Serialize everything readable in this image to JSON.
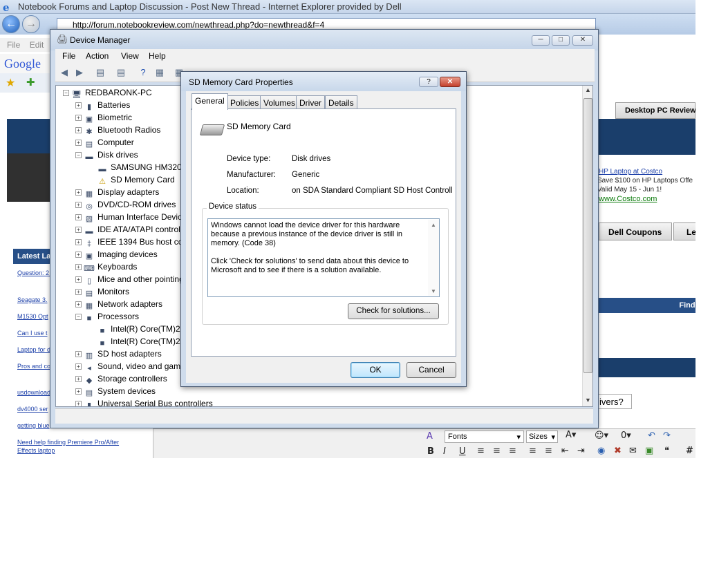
{
  "browser": {
    "title": "Notebook Forums and Laptop Discussion - Post New Thread - Internet Explorer provided by Dell",
    "address": "http://forum.notebookreview.com/newthread.php?do=newthread&f=4",
    "menu_file": "File",
    "menu_edit": "Edit",
    "google": "Google"
  },
  "site": {
    "latest_header": "Latest La",
    "links": [
      "Question: 2 Core 2 Duo",
      "Seagate 3.",
      "M1530 Opt",
      "Can I use t",
      "Laptop for d",
      "Pros and co resolutions",
      "usdownload",
      "dv4000 ser",
      "getting blue",
      "Need help finding Premiere Pro/After Effects laptop"
    ],
    "tab_desktop": "Desktop PC Reviews",
    "ad_title": "HP Laptop at Costco",
    "ad_line1": "Save $100 on HP Laptops Offe",
    "ad_line2": "Valid May 15 - Jun 1!",
    "ad_url": "www.Costco.com",
    "tab_dell": "Dell Coupons",
    "tab_le": "Le",
    "find_bar": "Find P",
    "question_tail": "ivers?",
    "editor_fonts": "Fonts",
    "editor_sizes": "Sizes"
  },
  "device_manager": {
    "title": "Device Manager",
    "menu": [
      "File",
      "Action",
      "View",
      "Help"
    ],
    "root": "REDBARONK-PC",
    "nodes": [
      {
        "label": "Batteries",
        "icon": "battery-icon"
      },
      {
        "label": "Biometric",
        "icon": "biometric-icon"
      },
      {
        "label": "Bluetooth Radios",
        "icon": "bluetooth-icon"
      },
      {
        "label": "Computer",
        "icon": "computer-icon"
      },
      {
        "label": "Disk drives",
        "icon": "disk-drive-icon"
      },
      {
        "label": "SAMSUNG HM320JI",
        "icon": "disk-drive-icon"
      },
      {
        "label": "SD Memory Card",
        "icon": "warning-disk-icon"
      },
      {
        "label": "Display adapters",
        "icon": "display-adapter-icon"
      },
      {
        "label": "DVD/CD-ROM drives",
        "icon": "dvd-icon"
      },
      {
        "label": "Human Interface Devices",
        "icon": "hid-icon"
      },
      {
        "label": "IDE ATA/ATAPI controllers",
        "icon": "ide-icon"
      },
      {
        "label": "IEEE 1394 Bus host controllers",
        "icon": "ieee1394-icon"
      },
      {
        "label": "Imaging devices",
        "icon": "camera-icon"
      },
      {
        "label": "Keyboards",
        "icon": "keyboard-icon"
      },
      {
        "label": "Mice and other pointing devices",
        "icon": "mouse-icon"
      },
      {
        "label": "Monitors",
        "icon": "monitor-icon"
      },
      {
        "label": "Network adapters",
        "icon": "network-icon"
      },
      {
        "label": "Processors",
        "icon": "processor-icon"
      },
      {
        "label": "Intel(R) Core(TM)2",
        "icon": "processor-icon"
      },
      {
        "label": "Intel(R) Core(TM)2",
        "icon": "processor-icon"
      },
      {
        "label": "SD host adapters",
        "icon": "sd-host-icon"
      },
      {
        "label": "Sound, video and game controllers",
        "icon": "speaker-icon"
      },
      {
        "label": "Storage controllers",
        "icon": "storage-icon"
      },
      {
        "label": "System devices",
        "icon": "system-icon"
      },
      {
        "label": "Universal Serial Bus controllers",
        "icon": "usb-icon"
      }
    ]
  },
  "dialog": {
    "title": "SD Memory Card Properties",
    "help": "?",
    "tabs": [
      "General",
      "Policies",
      "Volumes",
      "Driver",
      "Details"
    ],
    "device_name": "SD Memory Card",
    "device_type_label": "Device type:",
    "device_type_value": "Disk drives",
    "manufacturer_label": "Manufacturer:",
    "manufacturer_value": "Generic",
    "location_label": "Location:",
    "location_value": "on SDA Standard Compliant SD Host Controlle",
    "status_group": "Device status",
    "status_text": "Windows cannot load the device driver for this hardware because a previous instance of the device driver is still in memory. (Code 38)\n\nClick 'Check for solutions' to send data about this device to Microsoft and to see if there is a solution available.",
    "check_button": "Check for solutions...",
    "ok": "OK",
    "cancel": "Cancel"
  }
}
